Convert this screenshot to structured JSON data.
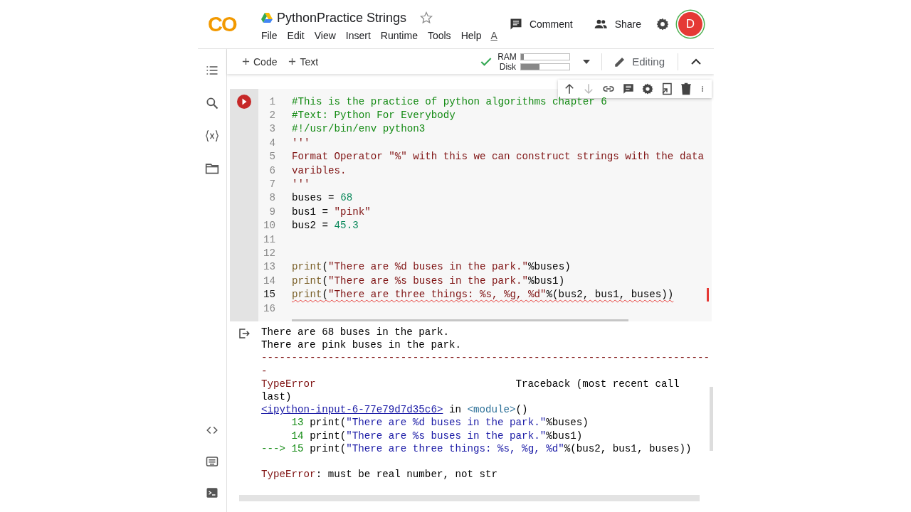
{
  "header": {
    "logo": "CO",
    "title": "PythonPractice Strings",
    "starred": false,
    "menu": [
      "File",
      "Edit",
      "View",
      "Insert",
      "Runtime",
      "Tools",
      "Help"
    ],
    "menu_extra": "A",
    "comment": "Comment",
    "share": "Share",
    "avatar": "D"
  },
  "toolbar": {
    "add_code": "Code",
    "add_text": "Text",
    "ram_label": "RAM",
    "disk_label": "Disk",
    "ram": {
      "level": 0.05
    },
    "disk": {
      "level": 0.38
    },
    "editing": "Editing"
  },
  "cell": {
    "lines": [
      {
        "number": "1",
        "active": false,
        "error": false,
        "segments": [
          {
            "kind": "comment",
            "text": "#This is the practice of python algorithms chapter 6"
          }
        ]
      },
      {
        "number": "2",
        "active": false,
        "error": false,
        "segments": [
          {
            "kind": "comment",
            "text": "#Text: Python For Everybody"
          }
        ]
      },
      {
        "number": "3",
        "active": false,
        "error": false,
        "segments": [
          {
            "kind": "comment",
            "text": "#!/usr/bin/env python3"
          }
        ]
      },
      {
        "number": "4",
        "active": false,
        "error": false,
        "segments": [
          {
            "kind": "string",
            "text": "'''"
          }
        ]
      },
      {
        "number": "5",
        "active": false,
        "error": false,
        "segments": [
          {
            "kind": "string",
            "text": "Format Operator \"%\" with this we can construct strings with the data"
          }
        ]
      },
      {
        "number": "6",
        "active": false,
        "error": false,
        "segments": [
          {
            "kind": "string",
            "text": "varibles."
          }
        ]
      },
      {
        "number": "7",
        "active": false,
        "error": false,
        "segments": [
          {
            "kind": "string",
            "text": "'''"
          }
        ]
      },
      {
        "number": "8",
        "active": false,
        "error": false,
        "segments": [
          {
            "kind": "plain",
            "text": "buses = "
          },
          {
            "kind": "number",
            "text": "68"
          }
        ]
      },
      {
        "number": "9",
        "active": false,
        "error": false,
        "segments": [
          {
            "kind": "plain",
            "text": "bus1 = "
          },
          {
            "kind": "string",
            "text": "\"pink\""
          }
        ]
      },
      {
        "number": "10",
        "active": false,
        "error": false,
        "segments": [
          {
            "kind": "plain",
            "text": "bus2 = "
          },
          {
            "kind": "number",
            "text": "45.3"
          }
        ]
      },
      {
        "number": "11",
        "active": false,
        "error": false
      },
      {
        "number": "12",
        "active": false,
        "error": false
      },
      {
        "number": "13",
        "active": false,
        "error": false,
        "segments": [
          {
            "kind": "builtin",
            "text": "print"
          },
          {
            "kind": "plain",
            "text": "("
          },
          {
            "kind": "string",
            "text": "\"There are %d buses in the park.\""
          },
          {
            "kind": "plain",
            "text": "%buses)"
          }
        ]
      },
      {
        "number": "14",
        "active": false,
        "error": false,
        "segments": [
          {
            "kind": "builtin",
            "text": "print"
          },
          {
            "kind": "plain",
            "text": "("
          },
          {
            "kind": "string",
            "text": "\"There are %s buses in the park.\""
          },
          {
            "kind": "plain",
            "text": "%bus1)"
          }
        ]
      },
      {
        "number": "15",
        "active": true,
        "error": true,
        "segments": [
          {
            "kind": "builtin",
            "text": "print"
          },
          {
            "kind": "plain",
            "text": "("
          },
          {
            "kind": "string",
            "text": "\"There are three things: %s, %g, %d\""
          },
          {
            "kind": "plain",
            "text": "%(bus2, bus1, buses))"
          }
        ]
      },
      {
        "number": "16",
        "active": false,
        "error": false
      }
    ]
  },
  "output": {
    "lines": [
      {
        "segments": [
          {
            "kind": "plain",
            "text": "There are 68 buses in the park."
          }
        ]
      },
      {
        "segments": [
          {
            "kind": "plain",
            "text": "There are pink buses in the park."
          }
        ]
      },
      {
        "segments": [
          {
            "kind": "error",
            "text": "--------------------------------------------------------------------------"
          }
        ]
      },
      {
        "segments": [
          {
            "kind": "error",
            "text": "-"
          }
        ]
      },
      {
        "segments": [
          {
            "kind": "error",
            "text": "TypeError"
          },
          {
            "kind": "plain",
            "text": "                                 Traceback (most recent call"
          }
        ]
      },
      {
        "segments": [
          {
            "kind": "plain",
            "text": "last)"
          }
        ]
      },
      {
        "segments": [
          {
            "kind": "link",
            "text": "<ipython-input-6-77e79d7d35c6>"
          },
          {
            "kind": "plain",
            "text": " in "
          },
          {
            "kind": "module",
            "text": "<module>"
          },
          {
            "kind": "plain",
            "text": "()"
          }
        ]
      },
      {
        "segments": [
          {
            "kind": "lineno",
            "text": "     13 "
          },
          {
            "kind": "plain",
            "text": "print("
          },
          {
            "kind": "tstring",
            "text": "\"There are %d buses in the park.\""
          },
          {
            "kind": "plain",
            "text": "%buses)"
          }
        ]
      },
      {
        "segments": [
          {
            "kind": "lineno",
            "text": "     14 "
          },
          {
            "kind": "plain",
            "text": "print("
          },
          {
            "kind": "tstring",
            "text": "\"There are %s buses in the park.\""
          },
          {
            "kind": "plain",
            "text": "%bus1)"
          }
        ]
      },
      {
        "segments": [
          {
            "kind": "lineno",
            "text": "---> 15 "
          },
          {
            "kind": "plain",
            "text": "print("
          },
          {
            "kind": "tstring",
            "text": "\"There are three things: %s, %g, %d\""
          },
          {
            "kind": "plain",
            "text": "%(bus2, bus1, buses))"
          }
        ]
      }
    ],
    "error_message": {
      "segments": [
        {
          "kind": "error",
          "text": "TypeError"
        },
        {
          "kind": "plain",
          "text": ": must be real number, not str"
        }
      ]
    }
  }
}
